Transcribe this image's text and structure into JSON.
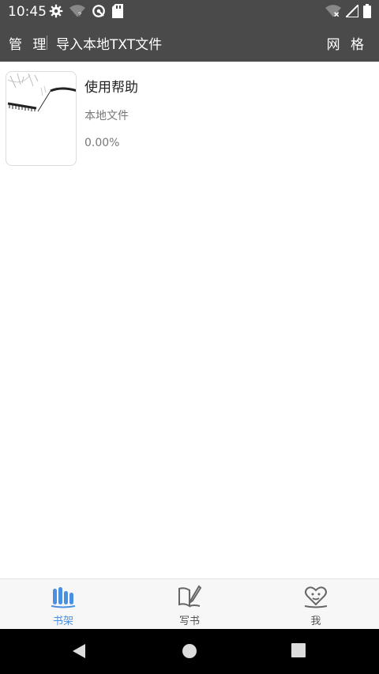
{
  "status_bar": {
    "time": "10:45",
    "left_icons": [
      "settings-icon",
      "wifi-question-icon",
      "data-saver-icon",
      "sd-card-icon"
    ],
    "right_icons": [
      "wifi-off-icon",
      "signal-icon",
      "battery-icon"
    ]
  },
  "toolbar": {
    "manage_label": "管 理",
    "import_label": "导入本地TXT文件",
    "grid_label": "网 格"
  },
  "books": [
    {
      "title": "使用帮助",
      "source": "本地文件",
      "progress": "0.00%"
    }
  ],
  "bottom_nav": {
    "tabs": [
      {
        "label": "书架",
        "icon": "bookshelf-icon",
        "active": true
      },
      {
        "label": "写书",
        "icon": "write-book-icon",
        "active": false
      },
      {
        "label": "我",
        "icon": "me-heart-icon",
        "active": false
      }
    ],
    "active_color": "#4a90e2",
    "inactive_color": "#555555"
  },
  "system_nav": [
    "back-icon",
    "home-icon",
    "recents-icon"
  ]
}
